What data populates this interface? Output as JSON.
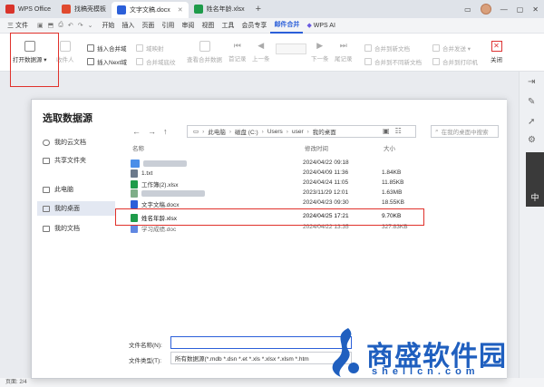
{
  "window": {
    "tabs": [
      {
        "label": "WPS Office",
        "color": "#d9342b"
      },
      {
        "label": "找稿壳模板",
        "color": "#e04a2e"
      },
      {
        "label": "文字文稿.docx",
        "color": "#2b5fd9"
      },
      {
        "label": "姓名年龄.xlsx",
        "color": "#1e9b4a"
      }
    ],
    "new_tab": "+"
  },
  "menubar": {
    "file": "三 文件",
    "items": [
      "开始",
      "插入",
      "页面",
      "引用",
      "审阅",
      "视图",
      "工具",
      "会员专享",
      "邮件合并"
    ],
    "active": "邮件合并",
    "wps_ai": "WPS AI"
  },
  "ribbon": {
    "open_source": "打开数据源",
    "insert_recipient": "收件人",
    "insert_merge_field": "插入合并域",
    "insert_next_field": "插入Next域",
    "merge_field": "域映射",
    "highlight_fields": "合并域底纹",
    "view_merged": "查看合并数据",
    "first": "首记录",
    "prev": "上一条",
    "next": "下一条",
    "last": "尾记录",
    "merge_to_new": "合并到新文档",
    "merge_to_files": "合并到不同新文档",
    "merge_send": "合并发送",
    "merge_to_printer": "合并到打印机",
    "close": "关闭"
  },
  "dialog": {
    "title": "选取数据源",
    "sidebar": [
      "我的云文档",
      "共享文件夹",
      "此电脑",
      "我的桌面",
      "我的文档"
    ],
    "selected_sidebar": "我的桌面",
    "path": [
      "此电脑",
      "磁盘 (C:)",
      "Users",
      "user",
      "我的桌面"
    ],
    "search_placeholder": "在我的桌面中搜索",
    "columns": {
      "name": "名称",
      "date": "修改时间",
      "size": "大小"
    },
    "files": [
      {
        "name": "",
        "date": "2024/04/22 09:18",
        "size": "",
        "type": "folder",
        "color": "#4a8ee8"
      },
      {
        "name": "1.txt",
        "date": "2024/04/09 11:36",
        "size": "1.84KB",
        "type": "txt",
        "color": "#6c7a8c"
      },
      {
        "name": "工作簿(2).xlsx",
        "date": "2024/04/24 11:05",
        "size": "11.85KB",
        "type": "xlsx",
        "color": "#1e9b4a"
      },
      {
        "name": "",
        "date": "2023/11/29 12:01",
        "size": "1.63MB",
        "type": "img",
        "color": "#7fae88"
      },
      {
        "name": "文字文稿.docx",
        "date": "2024/04/23 09:30",
        "size": "18.55KB",
        "type": "docx",
        "color": "#2b5fd9"
      },
      {
        "name": "姓名年龄.xlsx",
        "date": "2024/04/25 17:21",
        "size": "9.70KB",
        "type": "xlsx",
        "color": "#1e9b4a"
      },
      {
        "name": "学习成绩.doc",
        "date": "2024/04/22 13:35",
        "size": "327.83KB",
        "type": "doc",
        "color": "#2b5fd9"
      }
    ],
    "filename_label": "文件名称(N):",
    "filename_value": "",
    "filetype_label": "文件类型(T):",
    "filetype_value": "所有数据源(*.mdb *.dsn *.et *.xls *.xlsx *.xlsm *.htm"
  },
  "statusbar": {
    "page": "页面: 2/4"
  },
  "right_panel": {
    "thumb_text": "中"
  },
  "watermark": {
    "main": "商盛软件园",
    "sub": "shellcn.com"
  }
}
